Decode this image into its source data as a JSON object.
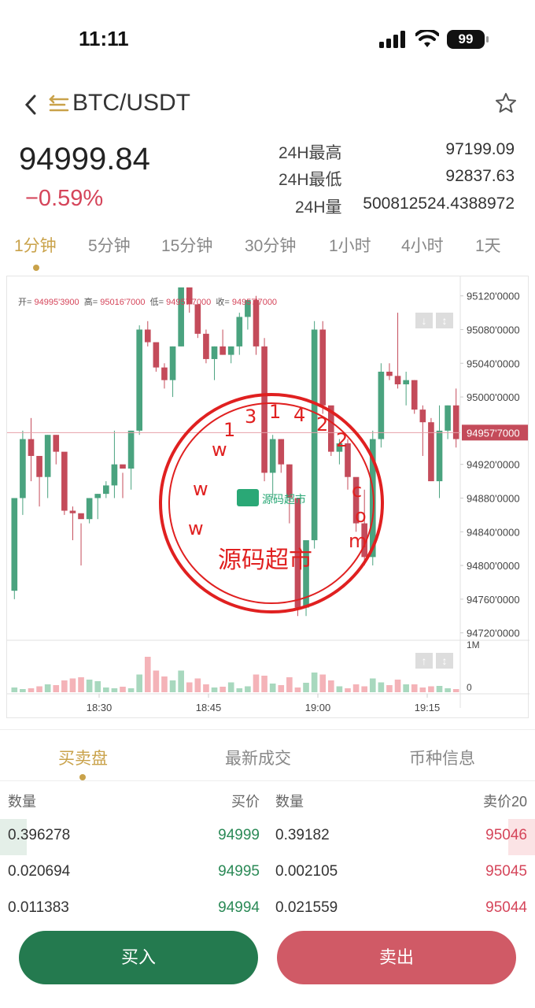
{
  "status": {
    "time": "11:11",
    "battery": "99"
  },
  "nav": {
    "pair": "BTC/USDT"
  },
  "ticker": {
    "last_price": "94999.84",
    "change": "−0.59%",
    "high_label": "24H最高",
    "high_value": "97199.09",
    "low_label": "24H最低",
    "low_value": "92837.63",
    "vol_label": "24H量",
    "vol_value": "500812524.4388972"
  },
  "timeframes": [
    "1分钟",
    "5分钟",
    "15分钟",
    "30分钟",
    "1小时",
    "4小时",
    "1天"
  ],
  "chart_info": {
    "open_label": "开=",
    "open": "94995'3900",
    "high_label": "高=",
    "high": "95016'7000",
    "low_label": "低=",
    "low": "94957'7000",
    "close_label": "收=",
    "close": "94957'7000",
    "current_price_tag": "94957'7000",
    "volume_axis_top": "1M",
    "volume_axis_bottom": "0"
  },
  "chart_data": {
    "type": "candlestick",
    "y_ticks": [
      "95120'0000",
      "95080'0000",
      "95040'0000",
      "95000'0000",
      "94920'0000",
      "94880'0000",
      "94840'0000",
      "94800'0000",
      "94760'0000",
      "94720'0000"
    ],
    "x_ticks": [
      "18:30",
      "18:45",
      "19:00",
      "19:15"
    ],
    "ylim": [
      94715,
      95130
    ],
    "candles": [
      [
        94770,
        94880,
        94760,
        94880
      ],
      [
        94880,
        94960,
        94860,
        94950
      ],
      [
        94950,
        94975,
        94900,
        94930
      ],
      [
        94930,
        94910,
        94870,
        94905
      ],
      [
        94905,
        94955,
        94880,
        94955
      ],
      [
        94955,
        94955,
        94920,
        94935
      ],
      [
        94935,
        94890,
        94860,
        94865
      ],
      [
        94865,
        94870,
        94830,
        94862
      ],
      [
        94862,
        94850,
        94800,
        94855
      ],
      [
        94855,
        94880,
        94850,
        94880
      ],
      [
        94880,
        94885,
        94855,
        94885
      ],
      [
        94885,
        94900,
        94880,
        94895
      ],
      [
        94895,
        94960,
        94880,
        94920
      ],
      [
        94920,
        94910,
        94880,
        94915
      ],
      [
        94915,
        94960,
        94890,
        94960
      ],
      [
        94960,
        95085,
        94955,
        95080
      ],
      [
        95080,
        95090,
        95060,
        95065
      ],
      [
        95065,
        95060,
        95030,
        95035
      ],
      [
        95035,
        95040,
        95010,
        95020
      ],
      [
        95020,
        95060,
        95000,
        95060
      ],
      [
        95060,
        95130,
        95060,
        95130
      ],
      [
        95130,
        95130,
        95100,
        95110
      ],
      [
        95110,
        95100,
        95070,
        95075
      ],
      [
        95075,
        95080,
        95040,
        95045
      ],
      [
        95045,
        95060,
        95020,
        95060
      ],
      [
        95060,
        95080,
        95050,
        95050
      ],
      [
        95050,
        95060,
        95040,
        95060
      ],
      [
        95060,
        95100,
        95050,
        95095
      ],
      [
        95095,
        95115,
        95080,
        95115
      ],
      [
        95115,
        95120,
        95050,
        95060
      ],
      [
        95060,
        95070,
        94900,
        94910
      ],
      [
        94910,
        94955,
        94880,
        94950
      ],
      [
        94950,
        94950,
        94910,
        94920
      ],
      [
        94920,
        94920,
        94850,
        94880
      ],
      [
        94880,
        94870,
        94740,
        94750
      ],
      [
        94750,
        94830,
        94740,
        94830
      ],
      [
        94830,
        95090,
        94820,
        95080
      ],
      [
        95080,
        95090,
        94980,
        94990
      ],
      [
        94990,
        94960,
        94930,
        94935
      ],
      [
        94935,
        94950,
        94920,
        94945
      ],
      [
        94945,
        94950,
        94890,
        94905
      ],
      [
        94905,
        94890,
        94840,
        94850
      ],
      [
        94850,
        94890,
        94800,
        94810
      ],
      [
        94810,
        94960,
        94800,
        94950
      ],
      [
        94950,
        95040,
        94940,
        95030
      ],
      [
        95030,
        95040,
        95020,
        95025
      ],
      [
        95025,
        95100,
        95010,
        95015
      ],
      [
        95015,
        95030,
        94990,
        95020
      ],
      [
        95020,
        95020,
        94980,
        94985
      ],
      [
        94985,
        94990,
        94930,
        94970
      ],
      [
        94970,
        94975,
        94900,
        94900
      ],
      [
        94900,
        94990,
        94880,
        94960
      ],
      [
        94960,
        94990,
        94950,
        94990
      ],
      [
        94990,
        95010,
        94940,
        94950
      ]
    ],
    "volume": [
      0.12,
      0.08,
      0.1,
      0.15,
      0.2,
      0.18,
      0.3,
      0.35,
      0.38,
      0.32,
      0.28,
      0.12,
      0.1,
      0.14,
      0.1,
      0.45,
      0.9,
      0.55,
      0.4,
      0.3,
      0.55,
      0.25,
      0.35,
      0.2,
      0.12,
      0.14,
      0.25,
      0.1,
      0.15,
      0.45,
      0.42,
      0.22,
      0.18,
      0.38,
      0.12,
      0.24,
      0.5,
      0.45,
      0.3,
      0.15,
      0.1,
      0.2,
      0.15,
      0.35,
      0.25,
      0.18,
      0.32,
      0.2,
      0.2,
      0.12,
      0.15,
      0.16,
      0.1,
      0.08
    ],
    "grid": true
  },
  "book_tabs": [
    "买卖盘",
    "最新成交",
    "币种信息"
  ],
  "book_headers": {
    "bid_qty": "数量",
    "bid_price": "买价",
    "ask_qty": "数量",
    "ask_price": "卖价20"
  },
  "book_rows": [
    {
      "bid_qty": "0.396278",
      "bid_price": "94999",
      "ask_qty": "0.39182",
      "ask_price": "95046",
      "bid_depth": 0.05,
      "ask_depth": 0.05
    },
    {
      "bid_qty": "0.020694",
      "bid_price": "94995",
      "ask_qty": "0.002105",
      "ask_price": "95045",
      "bid_depth": 0,
      "ask_depth": 0
    },
    {
      "bid_qty": "0.011383",
      "bid_price": "94994",
      "ask_qty": "0.021559",
      "ask_price": "95044",
      "bid_depth": 0,
      "ask_depth": 0
    }
  ],
  "actions": {
    "buy": "买入",
    "sell": "卖出"
  },
  "colors": {
    "up": "#4aa37f",
    "down": "#c44b5a",
    "accent": "#c9a24a",
    "buy_button": "#247a4f",
    "sell_button": "#d05a66"
  }
}
